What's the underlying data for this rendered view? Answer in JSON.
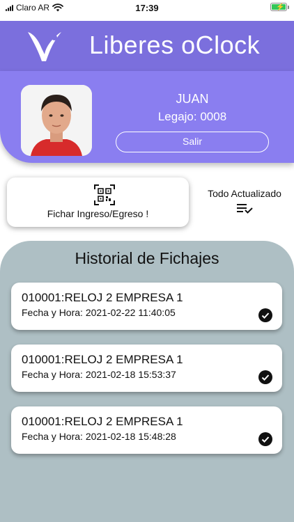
{
  "status_bar": {
    "carrier": "Claro AR",
    "time": "17:39"
  },
  "header": {
    "title": "Liberes oClock",
    "logo_icon": "liberes-checkmark-logo"
  },
  "profile": {
    "name": "JUAN",
    "legajo": "Legajo: 0008",
    "logout_label": "Salir",
    "avatar_icon": "user-photo"
  },
  "actions": {
    "fichar_label": "Fichar Ingreso/Egreso !",
    "fichar_icon": "qr-code-icon",
    "sync_label": "Todo Actualizado",
    "sync_icon": "playlist-check-icon"
  },
  "history": {
    "title": "Historial de Fichajes",
    "records": [
      {
        "title": "010001:RELOJ 2 EMPRESA 1",
        "date": "Fecha y Hora: 2021-02-22 11:40:05",
        "status_icon": "check-circle-icon"
      },
      {
        "title": "010001:RELOJ 2 EMPRESA 1",
        "date": "Fecha y Hora: 2021-02-18 15:53:37",
        "status_icon": "check-circle-icon"
      },
      {
        "title": "010001:RELOJ 2 EMPRESA 1",
        "date": "Fecha y Hora: 2021-02-18 15:48:28",
        "status_icon": "check-circle-icon"
      }
    ]
  },
  "colors": {
    "header": "#7b6fdd",
    "profile": "#8a7ef0",
    "history_bg": "#aebfc4",
    "battery": "#34c759"
  }
}
